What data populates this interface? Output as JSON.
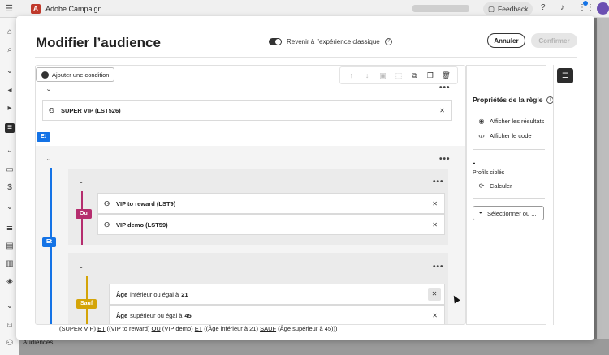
{
  "app": {
    "name": "Adobe Campaign",
    "feedback_label": "Feedback"
  },
  "background": {
    "nav_item_label": "Audiences"
  },
  "modal": {
    "title": "Modifier l’audience",
    "toggle_label": "Revenir à l’expérience classique",
    "cancel_label": "Annuler",
    "confirm_label": "Confirmer"
  },
  "editor": {
    "add_condition_label": "Ajouter une condition",
    "toolbar_icons": [
      "arrow-up-icon",
      "arrow-down-icon",
      "group-icon",
      "ungroup-icon",
      "duplicate-icon",
      "copy-icon",
      "delete-icon"
    ],
    "conditions": {
      "super_vip": "SUPER VIP (LST526)",
      "vip_reward": "VIP to reward (LST9)",
      "vip_demo": "VIP demo (LST59)",
      "age1_field": "Âge",
      "age1_op": "inférieur ou égal à",
      "age1_val": "21",
      "age2_field": "Âge",
      "age2_op": "supérieur ou égal à",
      "age2_val": "45"
    },
    "operators": {
      "et1": "Et",
      "et2": "Et",
      "ou": "Ou",
      "sauf": "Sauf"
    },
    "expression": {
      "p1": "(SUPER VIP) ",
      "et1": "ET",
      "p2": " ((VIP to reward) ",
      "ou": "OU",
      "p3": " (VIP demo) ",
      "et2": "ET",
      "p4": " ((Âge inférieur à 21) ",
      "sauf": "SAUF",
      "p5": " (Âge supérieur à 45)))"
    }
  },
  "panel": {
    "title": "Propriétés de la règle",
    "show_results": "Afficher les résultats",
    "show_code": "Afficher le code",
    "count": "-",
    "targeted_label": "Profils ciblés",
    "calculate": "Calculer",
    "select_label": "Sélectionner ou ..."
  },
  "colors": {
    "accent": "#1473e6",
    "ou": "#b52d6e",
    "sauf": "#d4a408"
  }
}
